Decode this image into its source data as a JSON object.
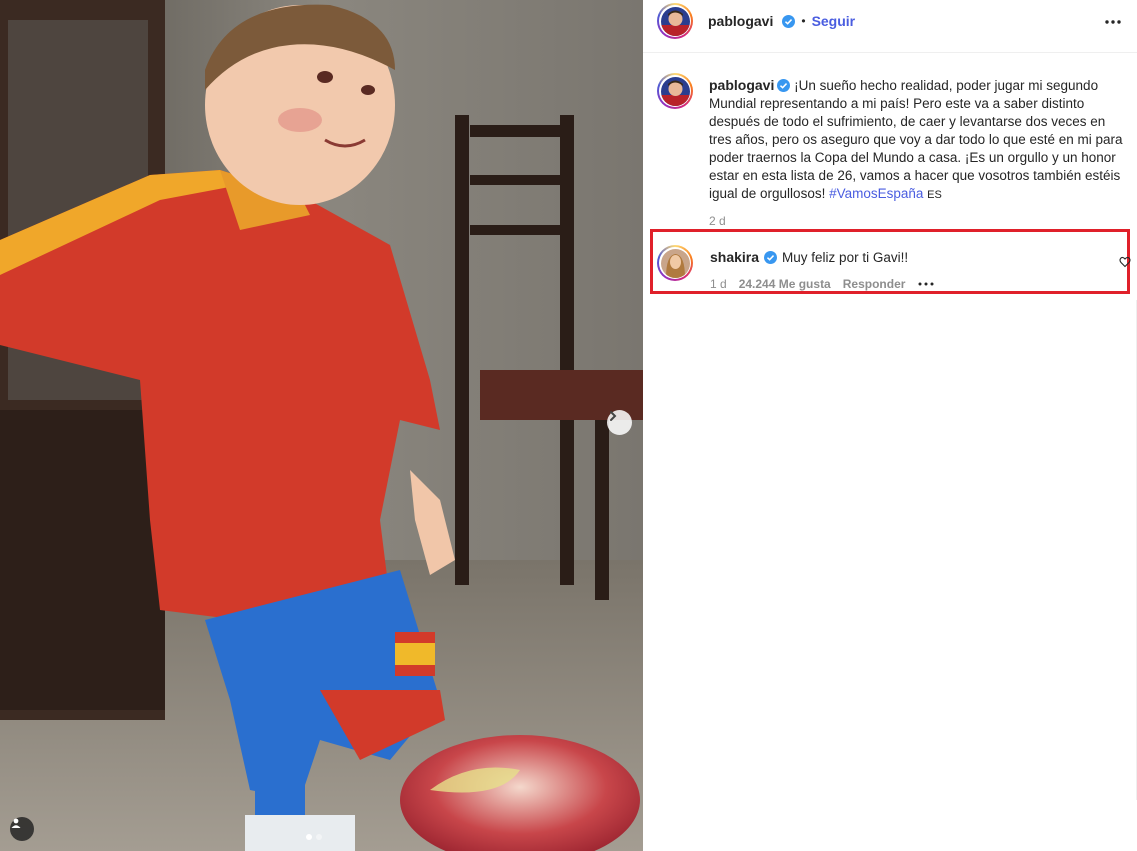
{
  "post": {
    "author": "pablogavi",
    "follow_label": "Seguir",
    "separator": "•",
    "caption": "¡Un sueño hecho realidad, poder jugar mi segundo Mundial representando a mi país! Pero este va a saber distinto después de todo el sufrimiento, de caer y levantarse dos veces en tres años, pero os aseguro que voy a dar todo lo que esté en mi para poder traernos la Copa del Mundo a casa. ¡Es un orgullo y un honor estar en esta lista de 26, vamos a hacer que vosotros también estéis igual de orgullosos! ",
    "hashtag": "#VamosEspaña",
    "flag_label": "ES",
    "time": "2 d"
  },
  "comment": {
    "author": "shakira",
    "text": "Muy feliz por ti Gavi!!",
    "time": "1 d",
    "likes": "24.244 Me gusta",
    "reply_label": "Responder"
  },
  "carousel": {
    "total": 2,
    "current": 1
  },
  "colors": {
    "link": "#4a5de0",
    "highlight_border": "#e0202a",
    "verified": "#3897f0"
  },
  "icons": [
    "verified-badge-icon",
    "more-options-icon",
    "chevron-right-icon",
    "tag-user-icon",
    "heart-icon"
  ]
}
